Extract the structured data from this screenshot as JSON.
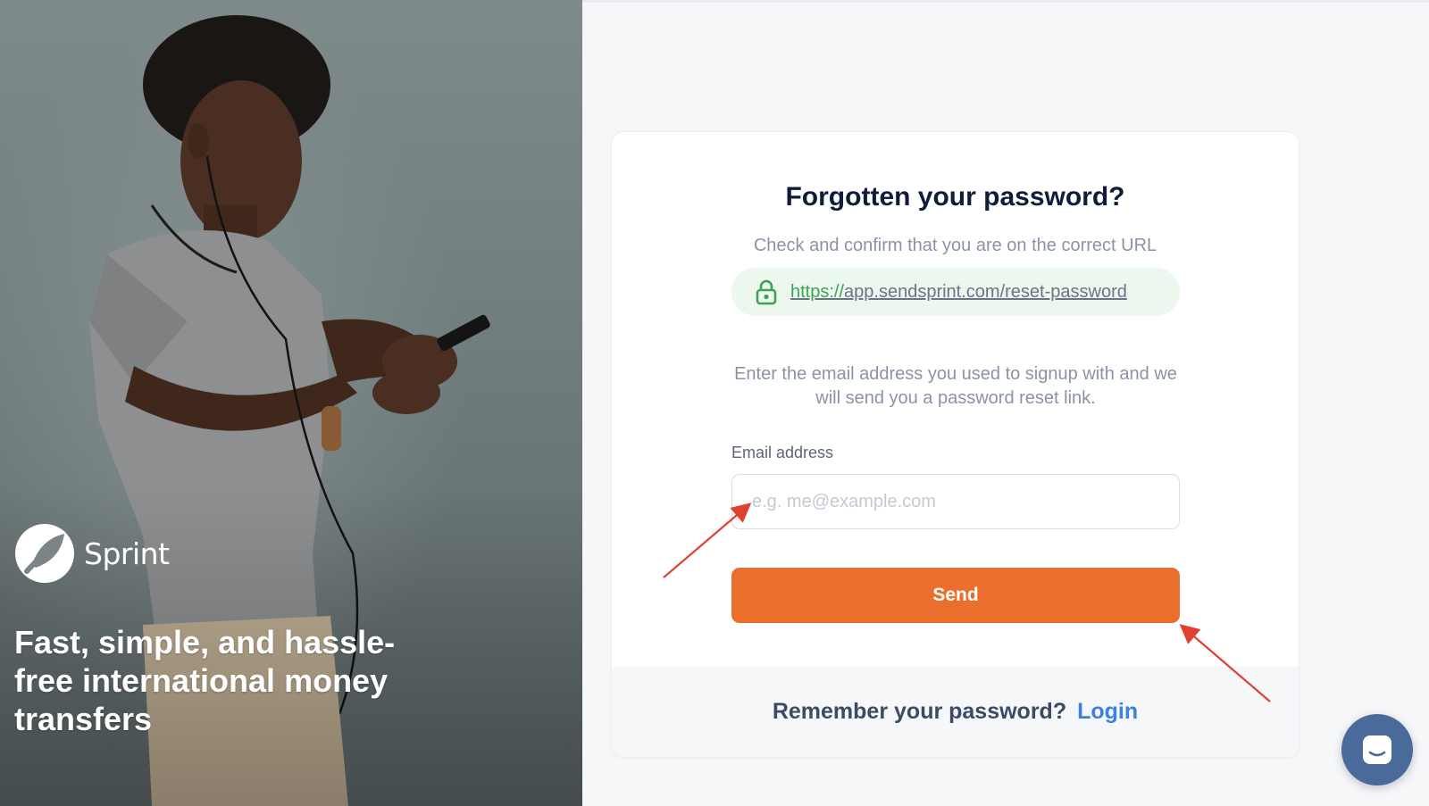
{
  "hero": {
    "brand_name": "Sprint",
    "tagline": "Fast, simple, and hassle-free international money transfers"
  },
  "card": {
    "title": "Forgotten your password?",
    "url_hint": "Check and confirm that you are on the correct URL",
    "url_protocol": "https://",
    "url_rest": "app.sendsprint.com/reset-password",
    "instructions": "Enter the email address you used to signup with and we will send you a password reset link.",
    "email_label": "Email address",
    "email_placeholder": "e.g. me@example.com",
    "email_value": "",
    "send_label": "Send",
    "footer_text": "Remember your password?",
    "login_label": "Login"
  },
  "colors": {
    "accent": "#ea6f2d",
    "link": "#3b82e0",
    "secure_green": "#3aa453",
    "title": "#0f1d3a",
    "annotation_arrow": "#e0412f",
    "chat_button": "#4a6a9a"
  },
  "icons": [
    "sprint-logo-icon",
    "lock-icon",
    "chat-icon",
    "annotation-arrow"
  ]
}
